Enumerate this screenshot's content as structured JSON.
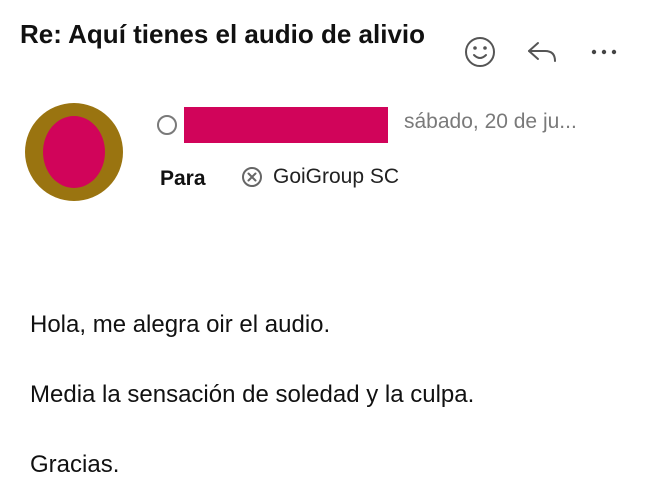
{
  "email": {
    "subject": "Re: Aquí tienes el audio de alivio",
    "date": "sábado, 20 de ju...",
    "to_label": "Para",
    "recipient": "GoiGroup SC",
    "body": [
      "Hola, me alegra oir el audio.",
      "Media la sensación de soledad y la culpa.",
      "Gracias."
    ]
  },
  "actions": {
    "react_icon": "smiley-icon",
    "reply_icon": "reply-arrow-icon",
    "more_icon": "more-horizontal-icon"
  },
  "colors": {
    "avatar_ring": "#9a7410",
    "avatar_fill": "#d1045a",
    "redaction": "#d1045a",
    "muted_text": "#7a7a7a"
  }
}
